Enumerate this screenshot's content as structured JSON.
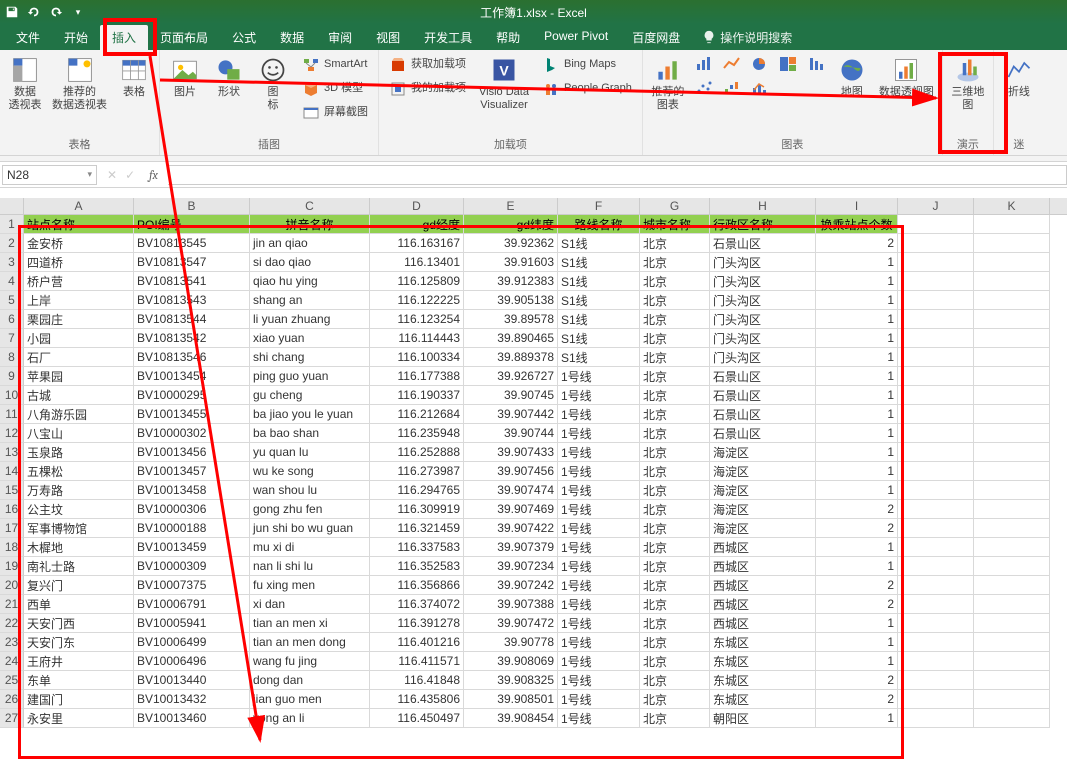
{
  "titlebar": {
    "title": "工作簿1.xlsx - Excel"
  },
  "tabs": {
    "items": [
      "文件",
      "开始",
      "插入",
      "页面布局",
      "公式",
      "数据",
      "审阅",
      "视图",
      "开发工具",
      "帮助",
      "Power Pivot",
      "百度网盘"
    ],
    "active_index": 2,
    "search_hint": "操作说明搜索"
  },
  "ribbon": {
    "groups": {
      "tables": {
        "label": "表格",
        "pivot": "数据\n透视表",
        "recommended_pivot": "推荐的\n数据透视表",
        "table": "表格"
      },
      "illustrations": {
        "label": "插图",
        "pictures": "图片",
        "shapes": "形状",
        "icons": "图\n标",
        "smartart": "SmartArt",
        "model3d": "3D 模型",
        "screenshot": "屏幕截图"
      },
      "addins": {
        "label": "加载项",
        "get": "获取加载项",
        "my": "我的加载项",
        "visio": "Visio Data\nVisualizer",
        "bing": "Bing Maps",
        "people": "People Graph"
      },
      "charts": {
        "label": "图表",
        "recommended": "推荐的\n图表",
        "map": "地图",
        "pivotchart": "数据透视图"
      },
      "tours": {
        "label": "演示",
        "map3d": "三维地\n图"
      },
      "sparklines": {
        "label": "迷",
        "line": "折线"
      }
    }
  },
  "namebox": "N28",
  "col_headers": [
    "A",
    "B",
    "C",
    "D",
    "E",
    "F",
    "G",
    "H",
    "I",
    "J",
    "K"
  ],
  "header_row": [
    "站点名称",
    "POI编号",
    "拼音名称",
    "gd经度",
    "gd纬度",
    "路线名称",
    "城市名称",
    "行政区名称",
    "换乘站点个数"
  ],
  "rows": [
    [
      "金安桥",
      "BV10813545",
      "jin an qiao",
      "116.163167",
      "39.92362",
      "S1线",
      "北京",
      "石景山区",
      "2"
    ],
    [
      "四道桥",
      "BV10813547",
      "si dao qiao",
      "116.13401",
      "39.91603",
      "S1线",
      "北京",
      "门头沟区",
      "1"
    ],
    [
      "桥户营",
      "BV10813541",
      "qiao hu ying",
      "116.125809",
      "39.912383",
      "S1线",
      "北京",
      "门头沟区",
      "1"
    ],
    [
      "上岸",
      "BV10813543",
      "shang an",
      "116.122225",
      "39.905138",
      "S1线",
      "北京",
      "门头沟区",
      "1"
    ],
    [
      "栗园庄",
      "BV10813544",
      "li yuan zhuang",
      "116.123254",
      "39.89578",
      "S1线",
      "北京",
      "门头沟区",
      "1"
    ],
    [
      "小园",
      "BV10813542",
      "xiao yuan",
      "116.114443",
      "39.890465",
      "S1线",
      "北京",
      "门头沟区",
      "1"
    ],
    [
      "石厂",
      "BV10813546",
      "shi chang",
      "116.100334",
      "39.889378",
      "S1线",
      "北京",
      "门头沟区",
      "1"
    ],
    [
      "苹果园",
      "BV10013454",
      "ping guo yuan",
      "116.177388",
      "39.926727",
      "1号线",
      "北京",
      "石景山区",
      "1"
    ],
    [
      "古城",
      "BV10000295",
      "gu cheng",
      "116.190337",
      "39.90745",
      "1号线",
      "北京",
      "石景山区",
      "1"
    ],
    [
      "八角游乐园",
      "BV10013455",
      "ba jiao you le yuan",
      "116.212684",
      "39.907442",
      "1号线",
      "北京",
      "石景山区",
      "1"
    ],
    [
      "八宝山",
      "BV10000302",
      "ba bao shan",
      "116.235948",
      "39.90744",
      "1号线",
      "北京",
      "石景山区",
      "1"
    ],
    [
      "玉泉路",
      "BV10013456",
      "yu quan lu",
      "116.252888",
      "39.907433",
      "1号线",
      "北京",
      "海淀区",
      "1"
    ],
    [
      "五棵松",
      "BV10013457",
      "wu ke song",
      "116.273987",
      "39.907456",
      "1号线",
      "北京",
      "海淀区",
      "1"
    ],
    [
      "万寿路",
      "BV10013458",
      "wan shou lu",
      "116.294765",
      "39.907474",
      "1号线",
      "北京",
      "海淀区",
      "1"
    ],
    [
      "公主坟",
      "BV10000306",
      "gong zhu fen",
      "116.309919",
      "39.907469",
      "1号线",
      "北京",
      "海淀区",
      "2"
    ],
    [
      "军事博物馆",
      "BV10000188",
      "jun shi bo wu guan",
      "116.321459",
      "39.907422",
      "1号线",
      "北京",
      "海淀区",
      "2"
    ],
    [
      "木樨地",
      "BV10013459",
      "mu xi di",
      "116.337583",
      "39.907379",
      "1号线",
      "北京",
      "西城区",
      "1"
    ],
    [
      "南礼士路",
      "BV10000309",
      "nan li shi lu",
      "116.352583",
      "39.907234",
      "1号线",
      "北京",
      "西城区",
      "1"
    ],
    [
      "复兴门",
      "BV10007375",
      "fu xing men",
      "116.356866",
      "39.907242",
      "1号线",
      "北京",
      "西城区",
      "2"
    ],
    [
      "西单",
      "BV10006791",
      "xi dan",
      "116.374072",
      "39.907388",
      "1号线",
      "北京",
      "西城区",
      "2"
    ],
    [
      "天安门西",
      "BV10005941",
      "tian an men xi",
      "116.391278",
      "39.907472",
      "1号线",
      "北京",
      "西城区",
      "1"
    ],
    [
      "天安门东",
      "BV10006499",
      "tian an men dong",
      "116.401216",
      "39.90778",
      "1号线",
      "北京",
      "东城区",
      "1"
    ],
    [
      "王府井",
      "BV10006496",
      "wang fu jing",
      "116.411571",
      "39.908069",
      "1号线",
      "北京",
      "东城区",
      "1"
    ],
    [
      "东单",
      "BV10013440",
      "dong dan",
      "116.41848",
      "39.908325",
      "1号线",
      "北京",
      "东城区",
      "2"
    ],
    [
      "建国门",
      "BV10013432",
      "jian guo men",
      "116.435806",
      "39.908501",
      "1号线",
      "北京",
      "东城区",
      "2"
    ],
    [
      "永安里",
      "BV10013460",
      "yong an li",
      "116.450497",
      "39.908454",
      "1号线",
      "北京",
      "朝阳区",
      "1"
    ]
  ]
}
